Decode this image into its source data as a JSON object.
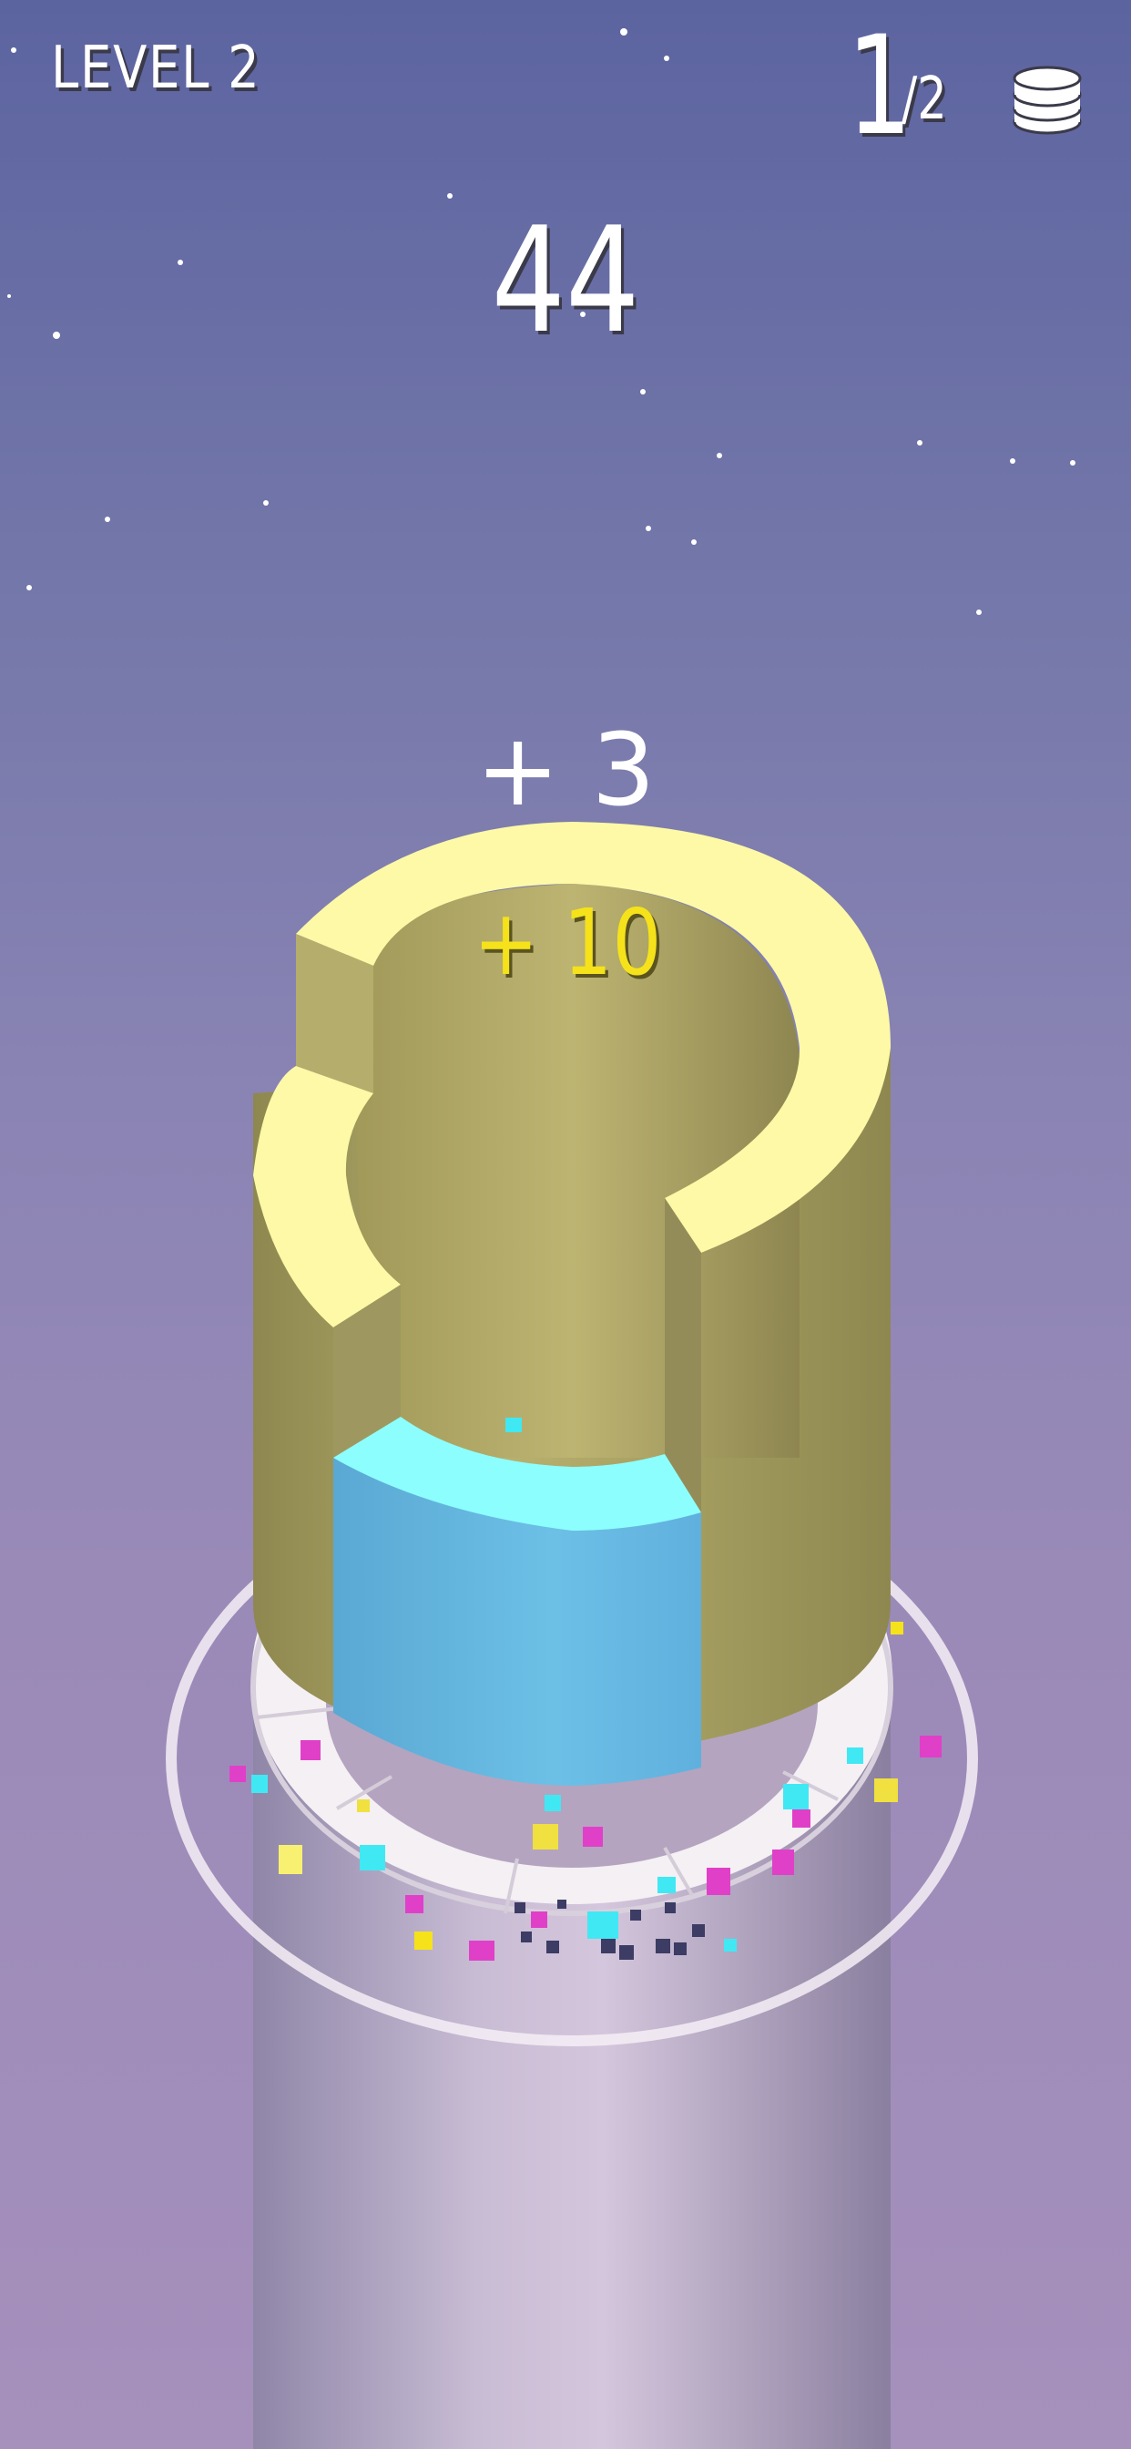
{
  "hud": {
    "level_label": "LEVEL 2",
    "progress_current": "1",
    "progress_total": "/2",
    "score": "44",
    "combo_bonus": "+ 3",
    "perfect_bonus": "+ 10",
    "coins_icon": "coin-stack-icon"
  },
  "colors": {
    "tower_yellow_top": "#fdf9a6",
    "tower_yellow_side": "#b5ad6c",
    "tower_cyan_top": "#8cfefe",
    "tower_cyan_side": "#68bce2",
    "bonus_yellow": "#f5e21a",
    "debris_magenta": "#e040c8",
    "debris_cyan": "#40e8f4"
  }
}
